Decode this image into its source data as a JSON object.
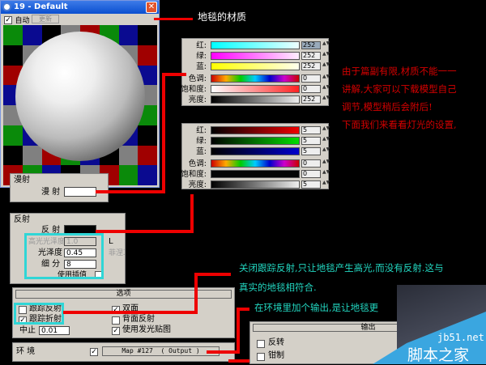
{
  "window": {
    "title": "19 - Default",
    "auto_label": "自动",
    "update_label": "更新",
    "auto_checked": true
  },
  "material_label": "地毯的材质",
  "color_panel_1": {
    "rows": [
      {
        "label": "红:",
        "value": "252"
      },
      {
        "label": "绿:",
        "value": "252"
      },
      {
        "label": "蓝:",
        "value": "252"
      },
      {
        "label": "色调:",
        "value": "0"
      },
      {
        "label": "饱和度:",
        "value": "0"
      },
      {
        "label": "亮度:",
        "value": "252"
      }
    ]
  },
  "color_panel_2": {
    "rows": [
      {
        "label": "红:",
        "value": "5"
      },
      {
        "label": "绿:",
        "value": "5"
      },
      {
        "label": "蓝:",
        "value": "5"
      },
      {
        "label": "色调:",
        "value": "0"
      },
      {
        "label": "饱和度:",
        "value": "0"
      },
      {
        "label": "亮度:",
        "value": "5"
      }
    ]
  },
  "note_red": [
    "由于篇副有限,材质不能一一",
    "讲解,大家可以下载模型自己",
    "调节,模型稍后会附后!",
    "下面我们来看看灯光的设置,"
  ],
  "diffuse": {
    "group": "漫射",
    "label": "漫 射"
  },
  "reflect": {
    "group": "反射",
    "label": "反 射",
    "hilight_gloss": "高光光泽度",
    "hilight_value": "1.0",
    "gloss": "光泽度",
    "gloss_value": "0.45",
    "subdivs": "细 分",
    "subdivs_value": "8",
    "interp": "使用插值",
    "lock": "L",
    "fresnel": "菲涅耳"
  },
  "options": {
    "title": "选项",
    "trace_reflect": "跟踪反射",
    "trace_reflect_checked": false,
    "trace_refract": "跟踪折射",
    "trace_refract_checked": true,
    "cutoff": "中止",
    "cutoff_value": "0.01",
    "double_sided": "双面",
    "double_sided_checked": true,
    "back_reflect": "背面反射",
    "back_reflect_checked": false,
    "use_glow": "使用发光贴图",
    "use_glow_checked": true
  },
  "environment": {
    "label": "环 境",
    "checked": true,
    "map": "Map #127  ( Output )"
  },
  "note_cyan": [
    "关闭跟踪反射,只让地毯产生高光,而没有反射.这与",
    "真实的地毯相符合.",
    "在环境里加个输出,是让地毯更"
  ],
  "output": {
    "title": "输出",
    "invert": "反转",
    "clamp": "钳制"
  },
  "watermark": {
    "url": "jb51.net",
    "name": "脚本之家"
  }
}
